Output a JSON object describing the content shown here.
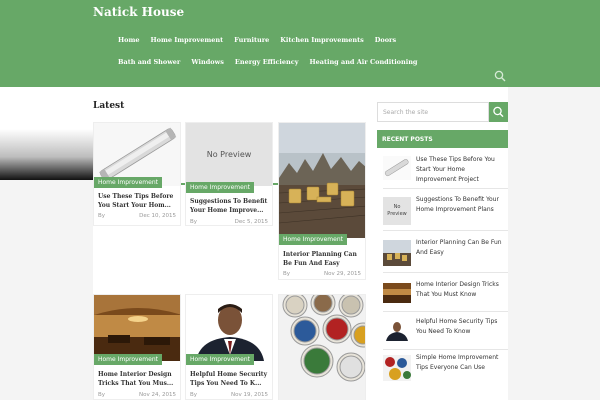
{
  "header": {
    "site_title": "Natick House",
    "nav": [
      "Home",
      "Home Improvement",
      "Furniture",
      "Kitchen Improvements",
      "Doors",
      "Bath and Shower",
      "Windows",
      "Energy Efficiency",
      "Heating and Air Conditioning"
    ],
    "search_icon": "search-icon"
  },
  "latest": {
    "title": "Latest",
    "cards": [
      {
        "category": "Home Improvement",
        "title": "Use These Tips Before You Start Your Hom...",
        "by": "By",
        "date": "Dec 10, 2015",
        "thumb": "fluorescent-lamp"
      },
      {
        "category": "Home Improvement",
        "title": "Suggestions To Benefit Your Home Improve...",
        "by": "By",
        "date": "Dec 5, 2015",
        "thumb": "no-preview",
        "no_preview_text": "No Preview"
      },
      {
        "category": "Home Improvement",
        "title": "Interior Planning Can Be Fun And Easy",
        "by": "By",
        "date": "Nov 29, 2015",
        "thumb": "deck-chairs"
      },
      {
        "category": "Home Improvement",
        "title": "Home Interior Design Tricks That You Mus...",
        "by": "By",
        "date": "Nov 24, 2015",
        "thumb": "interior-room"
      },
      {
        "category": "Home Improvement",
        "title": "Helpful Home Security Tips You Need To K...",
        "by": "By",
        "date": "Nov 19, 2015",
        "thumb": "man-portrait"
      },
      {
        "thumb": "paint-cans"
      }
    ]
  },
  "sidebar": {
    "search_placeholder": "Search the site",
    "recent_title": "RECENT POSTS",
    "recent_posts": [
      {
        "title": "Use These Tips Before You Start Your Home Improvement Project",
        "thumb": "fluorescent-lamp"
      },
      {
        "title": "Suggestions To Benefit Your Home Improvement Plans",
        "thumb": "no-preview",
        "no_preview_text": "No Preview"
      },
      {
        "title": "Interior Planning Can Be Fun And Easy",
        "thumb": "deck-chairs"
      },
      {
        "title": "Home Interior Design Tricks That You Must Know",
        "thumb": "interior-room"
      },
      {
        "title": "Helpful Home Security Tips You Need To Know",
        "thumb": "man-portrait"
      },
      {
        "title": "Simple Home Improvement Tips Everyone Can Use",
        "thumb": "paint-cans"
      }
    ]
  },
  "colors": {
    "accent": "#67a867"
  }
}
